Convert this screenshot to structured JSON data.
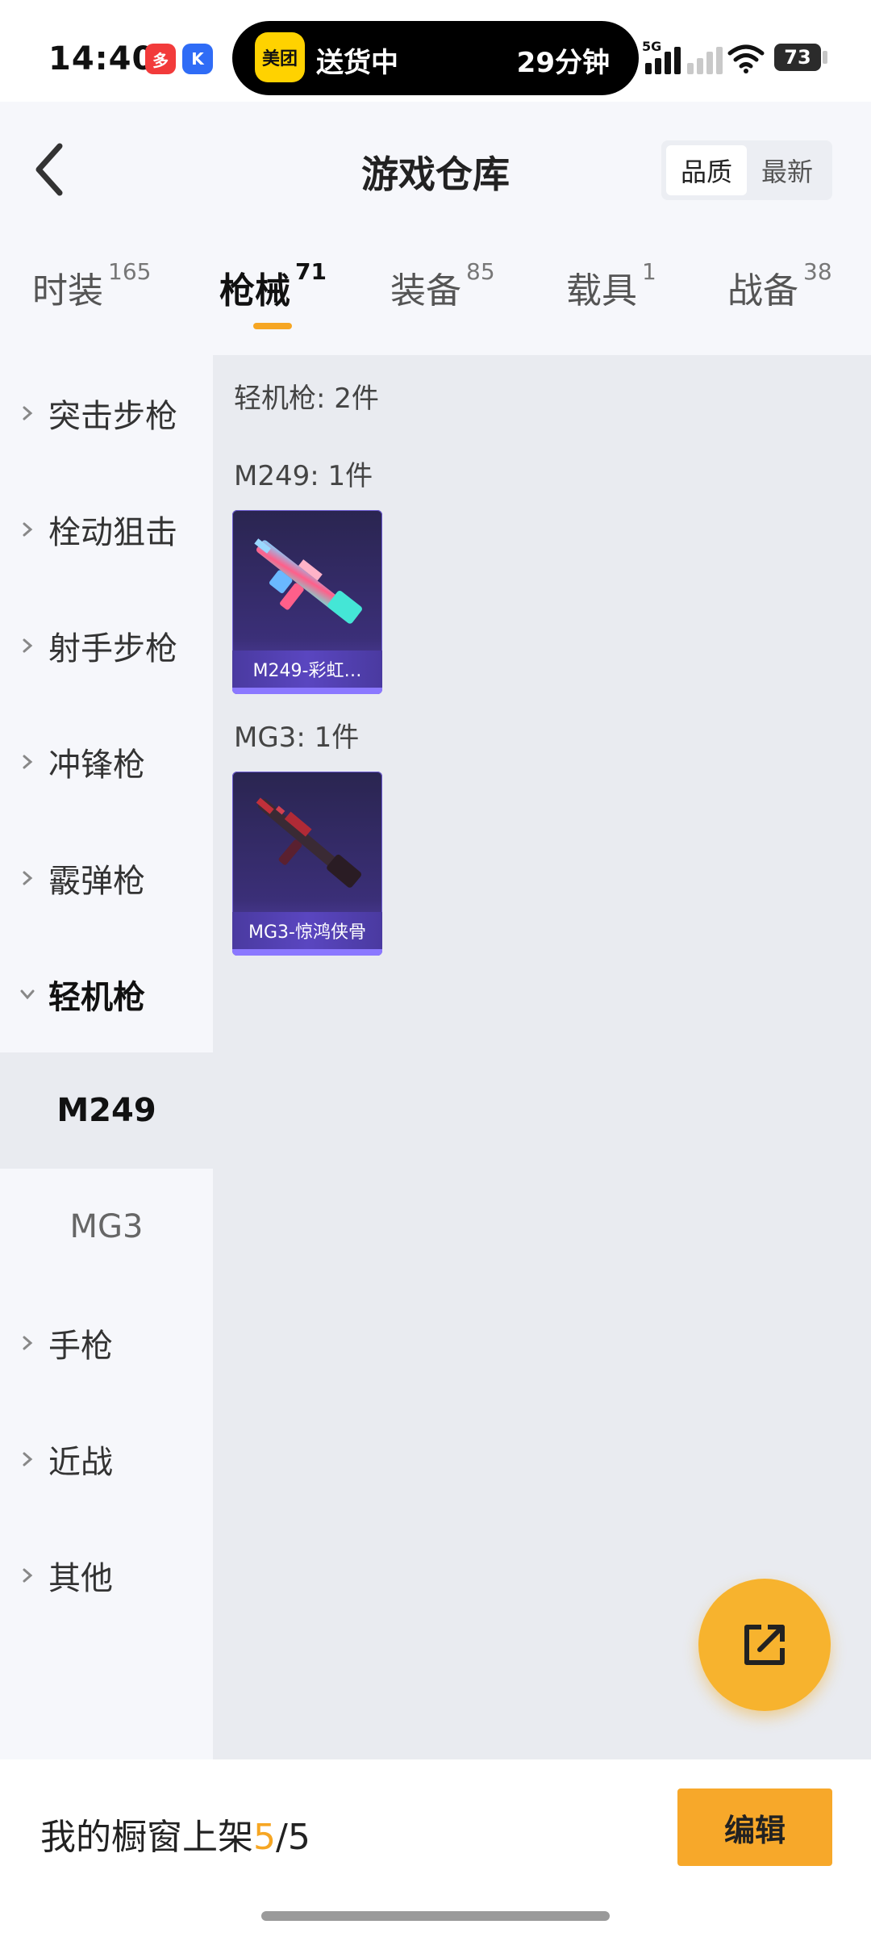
{
  "status_bar": {
    "time": "14:40",
    "app_badges": [
      "多",
      "K"
    ],
    "live_activity": {
      "app": "美团",
      "status": "送货中",
      "eta": "29分钟"
    },
    "network": "5G",
    "battery": "73"
  },
  "header": {
    "title": "游戏仓库",
    "sort": {
      "options": [
        "品质",
        "最新"
      ],
      "active": "品质"
    }
  },
  "tabs": [
    {
      "label": "时装",
      "count": "165",
      "active": false
    },
    {
      "label": "枪械",
      "count": "71",
      "active": true
    },
    {
      "label": "装备",
      "count": "85",
      "active": false
    },
    {
      "label": "载具",
      "count": "1",
      "active": false
    },
    {
      "label": "战备",
      "count": "38",
      "active": false
    }
  ],
  "sidebar": {
    "categories": [
      {
        "label": "突击步枪"
      },
      {
        "label": "栓动狙击"
      },
      {
        "label": "射手步枪"
      },
      {
        "label": "冲锋枪"
      },
      {
        "label": "霰弹枪"
      },
      {
        "label": "轻机枪",
        "expanded": true,
        "subs": [
          "M249",
          "MG3"
        ],
        "selected": "M249"
      },
      {
        "label": "手枪"
      },
      {
        "label": "近战"
      },
      {
        "label": "其他"
      }
    ],
    "sub_items": {
      "m249": "M249",
      "mg3": "MG3"
    }
  },
  "content": {
    "section_title": "轻机枪: 2件",
    "groups": [
      {
        "title": "M249: 1件",
        "items": [
          {
            "name": "M249-彩虹…"
          }
        ]
      },
      {
        "title": "MG3: 1件",
        "items": [
          {
            "name": "MG3-惊鸿侠骨"
          }
        ]
      }
    ]
  },
  "bottom_bar": {
    "label": "我的橱窗上架",
    "shown": "5",
    "separator": "/",
    "total": "5",
    "edit_label": "编辑"
  },
  "colors": {
    "accent": "#f6a623",
    "button": "#f7a82a",
    "card_bg": "#3b2f78",
    "content_bg": "#e9ebf0"
  },
  "icons": [
    "back-arrow-icon",
    "chevron-right-icon",
    "chevron-down-icon",
    "share-external-icon",
    "wifi-icon",
    "signal-icon",
    "battery-icon"
  ]
}
